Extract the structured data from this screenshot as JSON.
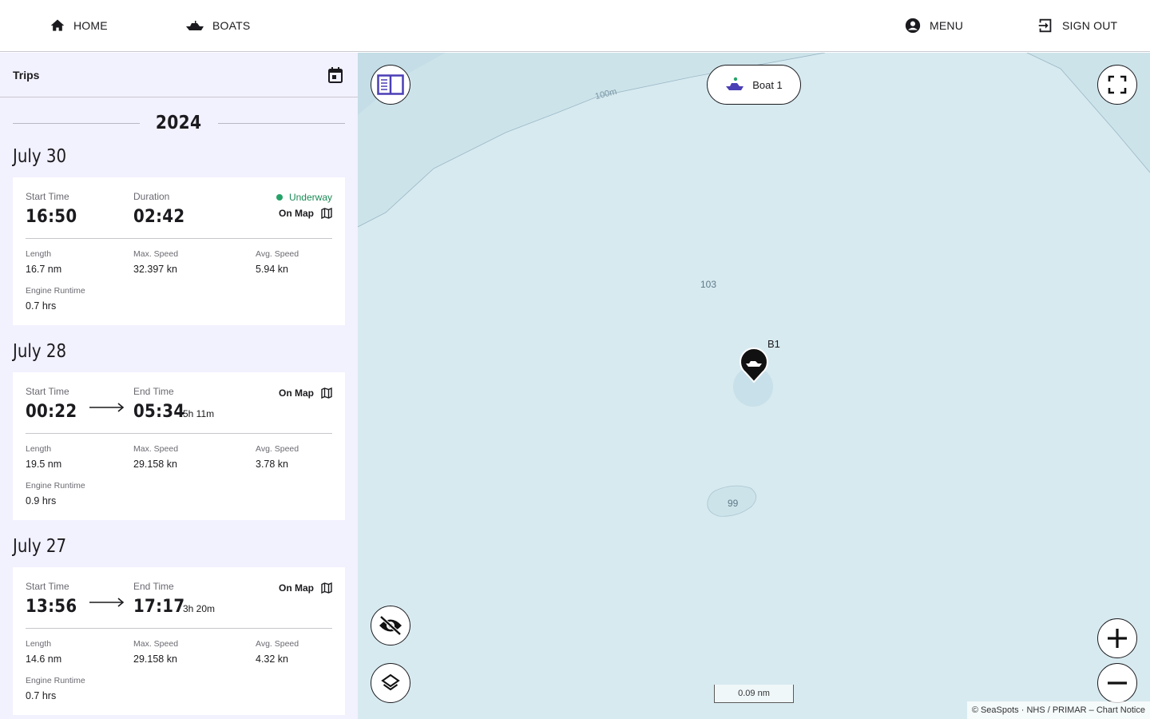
{
  "nav": {
    "home_label": "HOME",
    "boats_label": "BOATS",
    "menu_label": "MENU",
    "signout_label": "SIGN OUT"
  },
  "sidebar": {
    "title": "Trips",
    "year": "2024",
    "groups": [
      {
        "date": "July 30",
        "trip": {
          "start_label": "Start Time",
          "start_value": "16:50",
          "second_label": "Duration",
          "second_value": "02:42",
          "duration_suffix": "",
          "status": "Underway",
          "on_map_label": "On Map",
          "length_label": "Length",
          "length_value": "16.7 nm",
          "max_speed_label": "Max. Speed",
          "max_speed_value": "32.397 kn",
          "avg_speed_label": "Avg. Speed",
          "avg_speed_value": "5.94 kn",
          "engine_label": "Engine Runtime",
          "engine_value": "0.7 hrs"
        }
      },
      {
        "date": "July 28",
        "trip": {
          "start_label": "Start Time",
          "start_value": "00:22",
          "second_label": "End Time",
          "second_value": "05:34",
          "duration_suffix": "5h 11m",
          "status": "",
          "on_map_label": "On Map",
          "length_label": "Length",
          "length_value": "19.5  nm",
          "max_speed_label": "Max. Speed",
          "max_speed_value": "29.158  kn",
          "avg_speed_label": "Avg. Speed",
          "avg_speed_value": "3.78  kn",
          "engine_label": "Engine Runtime",
          "engine_value": "0.9  hrs"
        }
      },
      {
        "date": "July 27",
        "trip": {
          "start_label": "Start Time",
          "start_value": "13:56",
          "second_label": "End Time",
          "second_value": "17:17",
          "duration_suffix": "3h 20m",
          "status": "",
          "on_map_label": "On Map",
          "length_label": "Length",
          "length_value": "14.6  nm",
          "max_speed_label": "Max. Speed",
          "max_speed_value": "29.158  kn",
          "avg_speed_label": "Avg. Speed",
          "avg_speed_value": "4.32  kn",
          "engine_label": "Engine Runtime",
          "engine_value": "0.7  hrs"
        }
      }
    ]
  },
  "map": {
    "boat_selector_label": "Boat 1",
    "marker_label": "B1",
    "contour_label": "100m",
    "depth_labels": [
      "103",
      "99"
    ],
    "scale_label": "0.09 nm",
    "attribution": "© SeaSpots · NHS / PRIMAR – Chart Notice"
  },
  "colors": {
    "accent": "#4b3fb5",
    "sidebar_bg": "#f2f1fe",
    "map_water": "#d7eaf0",
    "status_green": "#26a269"
  }
}
